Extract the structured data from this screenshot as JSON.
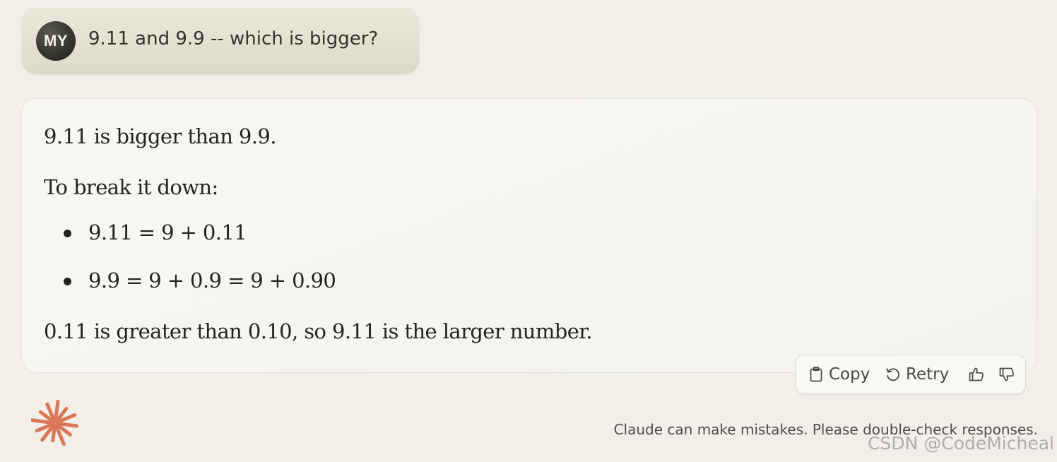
{
  "user_message": {
    "avatar_initials": "MY",
    "text": "9.11 and 9.9 -- which is bigger?"
  },
  "assistant_message": {
    "intro": "9.11 is bigger than 9.9.",
    "breakdown_heading": "To break it down:",
    "bullets": [
      "9.11 = 9 + 0.11",
      "9.9 = 9 + 0.9 = 9 + 0.90"
    ],
    "conclusion": "0.11 is greater than 0.10, so 9.11 is the larger number."
  },
  "actions": {
    "copy_label": "Copy",
    "retry_label": "Retry",
    "thumbs_up_icon": "thumbs-up-icon",
    "thumbs_down_icon": "thumbs-down-icon"
  },
  "footer": {
    "disclaimer": "Claude can make mistakes. Please double-check responses.",
    "watermark": "CSDN @CodeMicheal"
  },
  "colors": {
    "background": "#f1efe8",
    "user_bubble": "#e4e1d3",
    "avatar": "#3a3932",
    "card": "#f7f6f2",
    "claude_logo": "#d97757"
  }
}
